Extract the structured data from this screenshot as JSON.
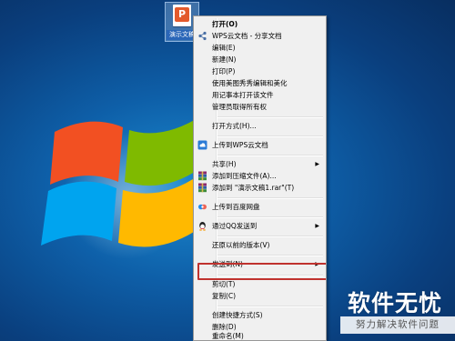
{
  "desktop_icon": {
    "label": "演示文稿",
    "letter": "P"
  },
  "menu": {
    "items": [
      {
        "label": "打开(O)",
        "bold": true
      },
      {
        "label": "WPS云文档 - 分享文档",
        "icon": "share-icon"
      },
      {
        "label": "编辑(E)"
      },
      {
        "label": "新建(N)"
      },
      {
        "label": "打印(P)"
      },
      {
        "label": "使用美图秀秀编辑和美化"
      },
      {
        "label": "用记事本打开该文件"
      },
      {
        "label": "管理员取得所有权"
      },
      {
        "label": "打开方式(H)..."
      },
      {
        "label": "上传到WPS云文档",
        "icon": "wps-cloud-icon"
      },
      {
        "label": "共享(H)",
        "submenu": true
      },
      {
        "label": "添加到压缩文件(A)...",
        "icon": "winrar-icon"
      },
      {
        "label": "添加到 \"演示文稿1.rar\"(T)",
        "icon": "winrar-icon"
      },
      {
        "label": "上传到百度网盘",
        "icon": "baidu-netdisk-icon"
      },
      {
        "label": "通过QQ发送到",
        "icon": "qq-icon",
        "submenu": true
      },
      {
        "label": "还原以前的版本(V)"
      },
      {
        "label": "发送到(N)",
        "submenu": true,
        "highlighted": true
      },
      {
        "label": "剪切(T)"
      },
      {
        "label": "复制(C)"
      },
      {
        "label": "创建快捷方式(S)"
      },
      {
        "label": "删除(D)"
      },
      {
        "label": "重命名(M)"
      }
    ],
    "submenu_arrow": "▶"
  },
  "watermark": {
    "main": "软件无忧",
    "sub": "努力解决软件问题"
  },
  "colors": {
    "highlight_border": "#c0322e",
    "menu_bg": "#f0f0f0"
  }
}
